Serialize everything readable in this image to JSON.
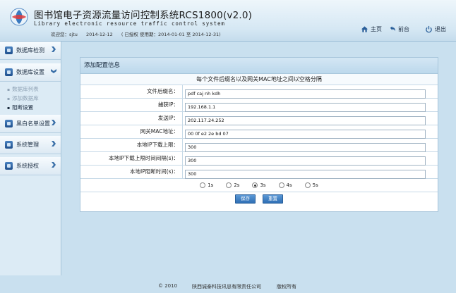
{
  "header": {
    "title": "图书馆电子资源流量访问控制系统RCS1800(v2.0)",
    "subtitle": "Library electronic resource traffic control system",
    "welcome_label": "欢迎您：sjtu",
    "date": "2014-12-12",
    "license": "( 已授权 使用期：2014-01-01 至 2014-12-31)",
    "nav": {
      "home": "主页",
      "back": "前台",
      "logout": "退出"
    }
  },
  "sidebar": {
    "items": [
      {
        "label": "数据库检测"
      },
      {
        "label": "数据库设置"
      },
      {
        "label": "黑白名单设置"
      },
      {
        "label": "系统管理"
      },
      {
        "label": "系统授权"
      }
    ],
    "sub_items": [
      {
        "label": "数据库列表"
      },
      {
        "label": "添加数据库"
      },
      {
        "label": "阻断设置"
      }
    ]
  },
  "panel": {
    "title": "添加配置信息",
    "notice": "每个文件后缀名以及网关MAC地址之间以空格分隔",
    "fields": [
      {
        "label": "文件后缀名：",
        "value": "pdf caj nh kdh"
      },
      {
        "label": "捕获IP：",
        "value": "192.168.1.1"
      },
      {
        "label": "发送IP：",
        "value": "202.117.24.252"
      },
      {
        "label": "网关MAC地址：",
        "value": "00 0f e2 2e bd 07"
      },
      {
        "label": "本地IP下载上限：",
        "value": "300"
      },
      {
        "label": "本地IP下载上限时间间隔(s)：",
        "value": "300"
      },
      {
        "label": "本地IP阻断时间(s)：",
        "value": "300"
      }
    ],
    "radios": [
      "1s",
      "2s",
      "3s",
      "4s",
      "5s"
    ],
    "selected_radio": "3s",
    "save_label": "保存",
    "reset_label": "重置"
  },
  "footer": {
    "copyright": "© 2010",
    "company": "陕西诚泰科技讯息有限责任公司",
    "rights": "版权所有"
  },
  "colors": {
    "accent": "#2f6fb4",
    "header_bg": "#d6e8f4",
    "page_bg": "#c9e0ef"
  }
}
